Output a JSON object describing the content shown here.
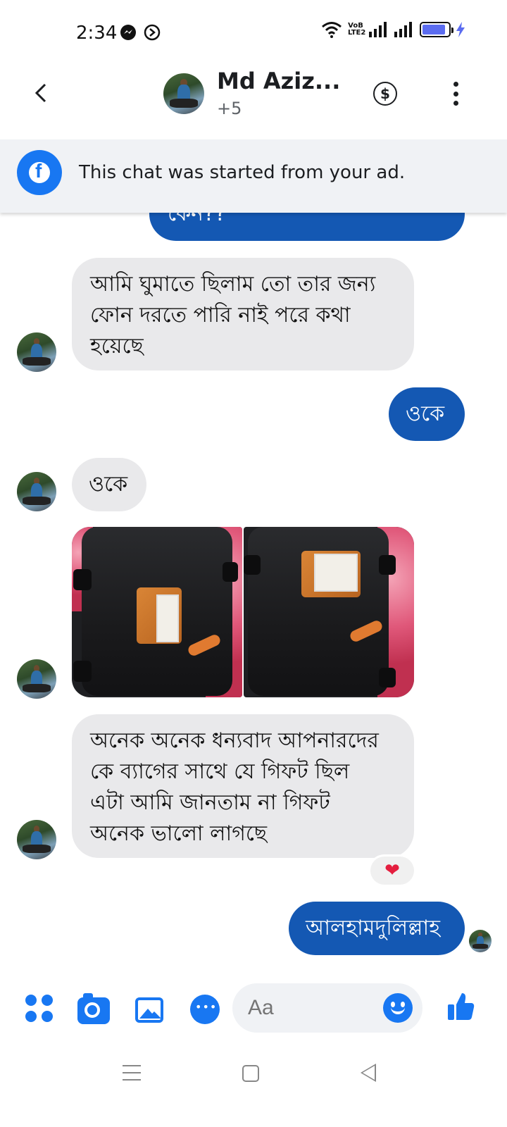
{
  "status_bar": {
    "time": "2:34",
    "network_label": "VoB LTE2"
  },
  "header": {
    "contact_name": "Md Aziz...",
    "participants_extra": "+5",
    "dollar_symbol": "$"
  },
  "ad_banner": {
    "text": "This chat was started from your ad."
  },
  "messages": [
    {
      "direction": "outgoing",
      "type": "text",
      "text": "কেন??"
    },
    {
      "direction": "incoming",
      "type": "text",
      "lines": [
        "আমি ঘুমাতে ছিলাম তো তার জন্য",
        "ফোন দরতে পারি নাই পরে কথা",
        "হয়েছে"
      ]
    },
    {
      "direction": "outgoing",
      "type": "text",
      "text": "ওকে"
    },
    {
      "direction": "incoming",
      "type": "text",
      "text": "ওকে"
    },
    {
      "direction": "incoming",
      "type": "photos",
      "count": 2
    },
    {
      "direction": "incoming",
      "type": "text",
      "lines": [
        "অনেক অনেক ধন্যবাদ আপনারদের",
        "কে ব্যাগের  সাথে যে গিফট ছিল",
        "এটা আমি জানতাম না গিফট",
        "অনেক ভালো লাগছে"
      ],
      "reaction": "❤"
    },
    {
      "direction": "outgoing",
      "type": "text",
      "text": "আলহামদুলিল্লাহ"
    }
  ],
  "composer": {
    "placeholder": "Aa"
  },
  "colors": {
    "messenger_blue": "#1877f2",
    "outgoing_bubble": "#1458b3",
    "incoming_bubble": "#e9e9eb",
    "reaction_heart": "#e41e3f"
  }
}
